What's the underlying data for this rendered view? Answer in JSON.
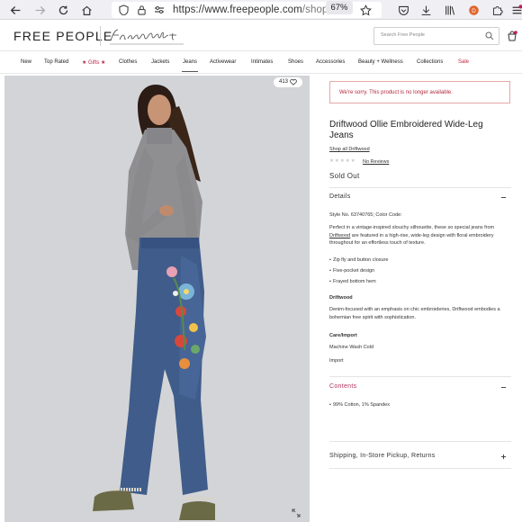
{
  "browser": {
    "url_domain": "https://www.freepeople.com",
    "url_path": "/shop/d",
    "zoom": "67%"
  },
  "header": {
    "logo": "FREE PEOPLE",
    "search_placeholder": "Search Free People"
  },
  "categories": [
    {
      "label": "New"
    },
    {
      "label": "Top Rated"
    },
    {
      "label": "★ Gifts ★"
    },
    {
      "label": "Clothes"
    },
    {
      "label": "Jackets"
    },
    {
      "label": "Jeans"
    },
    {
      "label": "Activewear"
    },
    {
      "label": "Intimates"
    },
    {
      "label": "Shoes"
    },
    {
      "label": "Accessories"
    },
    {
      "label": "Beauty + Wellness"
    },
    {
      "label": "Collections"
    },
    {
      "label": "Sale"
    }
  ],
  "photo": {
    "likes": "413"
  },
  "product": {
    "notice": "We're sorry. This product is no longer available.",
    "title": "Driftwood Ollie Embroidered Wide-Leg Jeans",
    "shop_all": "Shop all Driftwood",
    "reviews": "No Reviews",
    "status": "Sold Out"
  },
  "details": {
    "heading": "Details",
    "style_no": "Style No. 63740765; Color Code:",
    "description_pre": "Perfect in a vintage-inspired slouchy silhouette, these so special jeans from ",
    "description_brand": "Driftwood",
    "description_post": " are featured in a high-rise, wide-leg design with floral embroidery throughout for an effortless touch of texture.",
    "bullets": [
      "Zip fly and button closure",
      "Five-pocket design",
      "Frayed bottom hem"
    ],
    "brand_heading": "Driftwood",
    "brand_text": "Denim-focused with an emphasis on chic embroideries, Driftwood embodies a bohemian free spirit with sophistication.",
    "care_heading": "Care/Import",
    "care": "Machine Wash Cold",
    "import": "Import"
  },
  "contents": {
    "heading": "Contents",
    "items": [
      "99% Cotton, 1% Spandex"
    ]
  },
  "shipping": {
    "heading": "Shipping, In-Store Pickup, Returns"
  }
}
